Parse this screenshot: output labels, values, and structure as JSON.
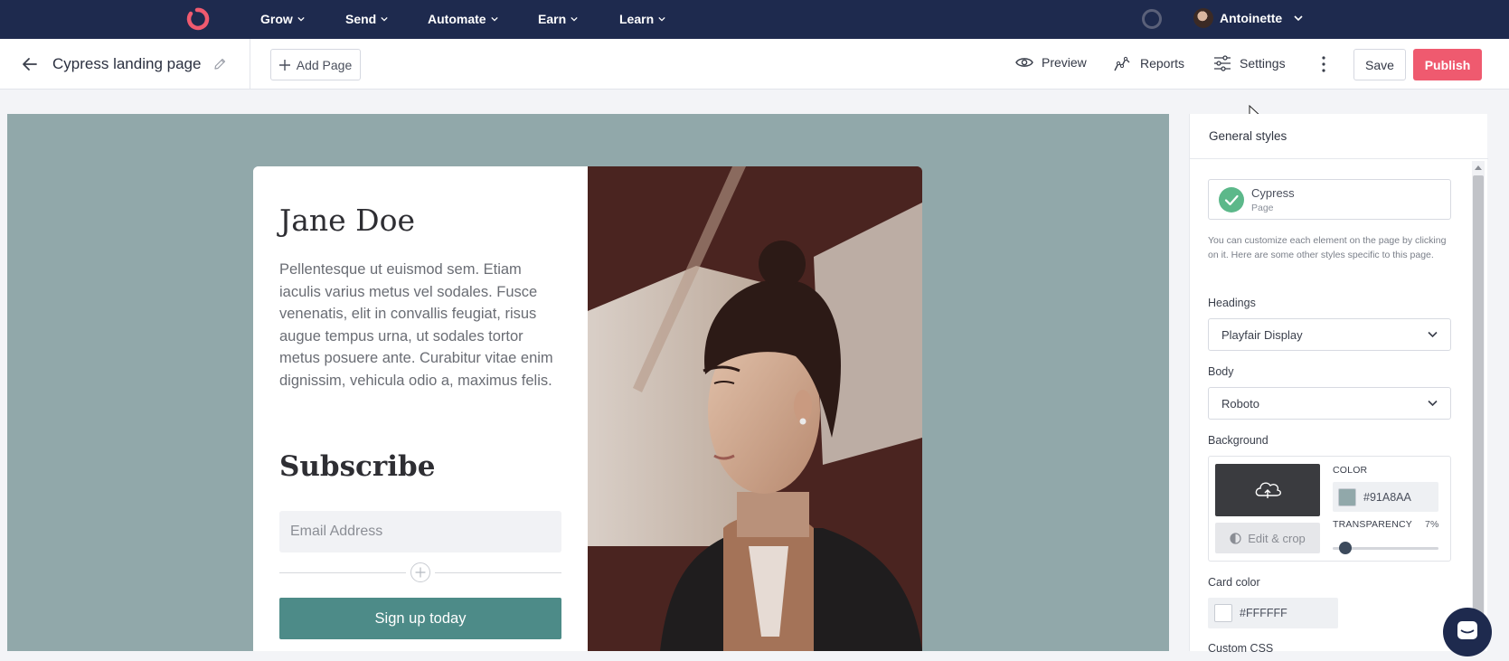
{
  "topnav": {
    "logo": "convertkit-logo",
    "items": [
      {
        "label": "Grow"
      },
      {
        "label": "Send"
      },
      {
        "label": "Automate"
      },
      {
        "label": "Earn"
      },
      {
        "label": "Learn"
      }
    ],
    "user_name": "Antoinette"
  },
  "toolbar": {
    "page_title": "Cypress landing page",
    "add_page_label": "Add Page",
    "preview_label": "Preview",
    "reports_label": "Reports",
    "settings_label": "Settings",
    "save_label": "Save",
    "publish_label": "Publish"
  },
  "card": {
    "heading": "Jane Doe",
    "body": "Pellentesque ut euismod sem. Etiam iaculis varius metus vel sodales. Fusce venenatis, elit in convallis feugiat, risus augue tempus urna, ut sodales tortor metus posuere ante. Curabitur vitae enim dignissim, vehicula odio a, maximus felis.",
    "subscribe_heading": "Subscribe",
    "email_placeholder": "Email Address",
    "button_label": "Sign up today"
  },
  "panel": {
    "header": "General styles",
    "theme": {
      "name": "Cypress",
      "type": "Page"
    },
    "help_text": "You can customize each element on the page by clicking on it. Here are some other styles specific to this page.",
    "headings_label": "Headings",
    "headings_value": "Playfair Display",
    "body_label": "Body",
    "body_value": "Roboto",
    "background_label": "Background",
    "color_label": "COLOR",
    "color_value": "#91A8AA",
    "edit_crop_label": "Edit & crop",
    "transparency_label": "TRANSPARENCY",
    "transparency_value": "7%",
    "transparency_fraction": 0.07,
    "card_color_label": "Card color",
    "card_color_value": "#FFFFFF",
    "custom_css_label": "Custom CSS"
  },
  "colors": {
    "nav_bg": "#1e2a4e",
    "publish": "#ef5a6f",
    "canvas_bg": "#91A8AA",
    "button_teal": "#4d8b88",
    "check_green": "#5cb88a",
    "card_bg": "#FFFFFF"
  }
}
